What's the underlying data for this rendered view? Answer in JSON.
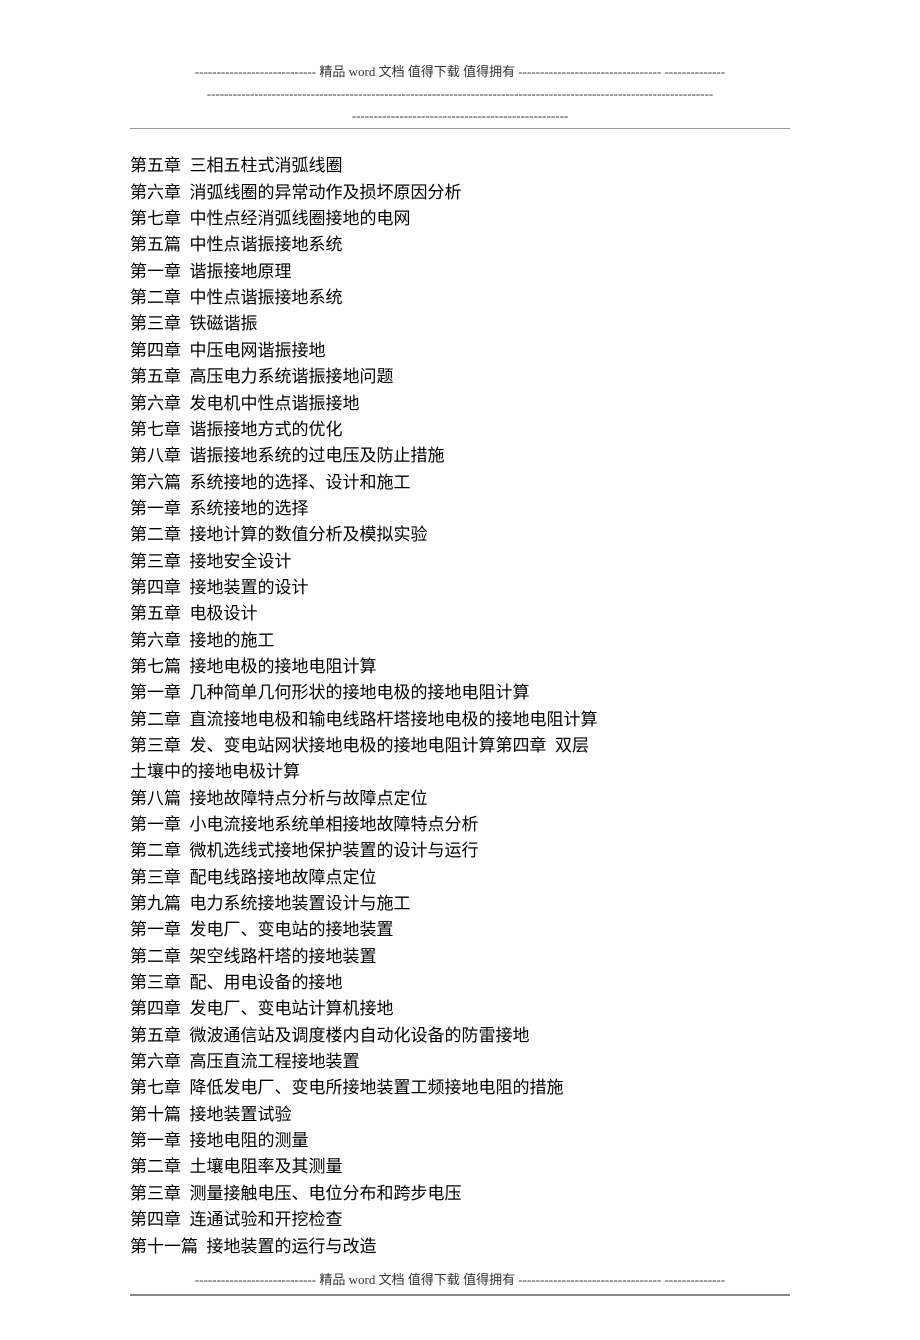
{
  "header": {
    "line1": "----------------------------            精品 word 文档    值得下载    值得拥有 ---------------------------------\n--------------",
    "line2": "---------------------------------------------------------------------------------------------------------------------",
    "line3": "--------------------------------------------------"
  },
  "toc": [
    "第五章  三相五柱式消弧线圈",
    "第六章  消弧线圈的异常动作及损坏原因分析",
    "第七章  中性点经消弧线圈接地的电网",
    "第五篇  中性点谐振接地系统",
    "第一章  谐振接地原理",
    "第二章  中性点谐振接地系统",
    "第三章  铁磁谐振",
    "第四章  中压电网谐振接地",
    "第五章  高压电力系统谐振接地问题",
    "第六章  发电机中性点谐振接地",
    "第七章  谐振接地方式的优化",
    "第八章  谐振接地系统的过电压及防止措施",
    "第六篇  系统接地的选择、设计和施工",
    "第一章  系统接地的选择",
    "第二章  接地计算的数值分析及模拟实验",
    "第三章  接地安全设计",
    "第四章  接地装置的设计",
    "第五章  电极设计",
    "第六章  接地的施工",
    "第七篇  接地电极的接地电阻计算",
    "第一章  几种简单几何形状的接地电极的接地电阻计算",
    "第二章  直流接地电极和输电线路杆塔接地电极的接地电阻计算",
    "第三章  发、变电站网状接地电极的接地电阻计算第四章  双层",
    "土壤中的接地电极计算",
    "第八篇  接地故障特点分析与故障点定位",
    "第一章  小电流接地系统单相接地故障特点分析",
    "第二章  微机选线式接地保护装置的设计与运行",
    "第三章  配电线路接地故障点定位",
    "第九篇  电力系统接地装置设计与施工",
    "第一章  发电厂、变电站的接地装置",
    "第二章  架空线路杆塔的接地装置",
    "第三章  配、用电设备的接地",
    "第四章  发电厂、变电站计算机接地",
    "第五章  微波通信站及调度楼内自动化设备的防雷接地",
    "第六章  高压直流工程接地装置",
    "第七章  降低发电厂、变电所接地装置工频接地电阻的措施",
    "第十篇  接地装置试验",
    "第一章  接地电阻的测量",
    "第二章  土壤电阻率及其测量",
    "第三章  测量接触电压、电位分布和跨步电压",
    "第四章  连通试验和开挖检查",
    "第十一篇  接地装置的运行与改造"
  ],
  "footer": {
    "line1": "----------------------------            精品 word 文档    值得下载    值得拥有 ---------------------------------\n--------------"
  }
}
